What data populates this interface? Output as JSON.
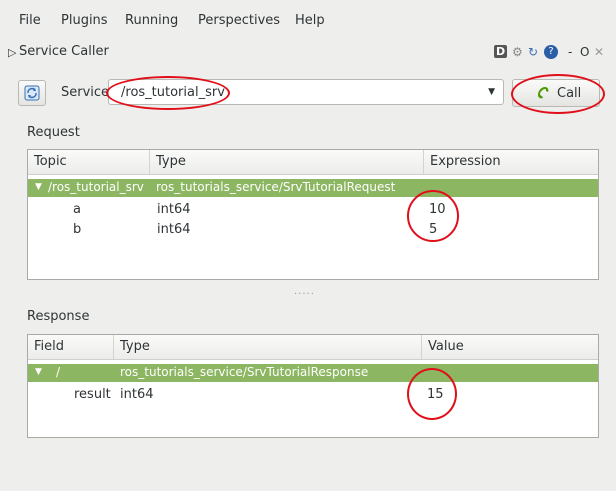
{
  "menu": [
    {
      "label": "File"
    },
    {
      "label": "Plugins"
    },
    {
      "label": "Running"
    },
    {
      "label": "Perspectives"
    },
    {
      "label": "Help"
    }
  ],
  "plugin_title": "Service Caller",
  "window_icons": {
    "help": "D",
    "dash": "-",
    "restore": "O",
    "close": "✕"
  },
  "service": {
    "label": "Service",
    "value": "/ros_tutorial_srv",
    "call_label": "Call"
  },
  "request": {
    "label": "Request",
    "columns": [
      "Topic",
      "Type",
      "Expression"
    ],
    "root": {
      "topic": "/ros_tutorial_srv",
      "type": "ros_tutorials_service/SrvTutorialRequest"
    },
    "rows": [
      {
        "name": "a",
        "type": "int64",
        "expression": "10"
      },
      {
        "name": "b",
        "type": "int64",
        "expression": "5"
      }
    ]
  },
  "splitter": "·····",
  "response": {
    "label": "Response",
    "columns": [
      "Field",
      "Type",
      "Value"
    ],
    "root": {
      "field": "/",
      "type": "ros_tutorials_service/SrvTutorialResponse"
    },
    "rows": [
      {
        "field": "result",
        "type": "int64",
        "value": "15"
      }
    ]
  },
  "colors": {
    "highlight_row": "#8cb661",
    "annotation_red": "#e0101b"
  }
}
